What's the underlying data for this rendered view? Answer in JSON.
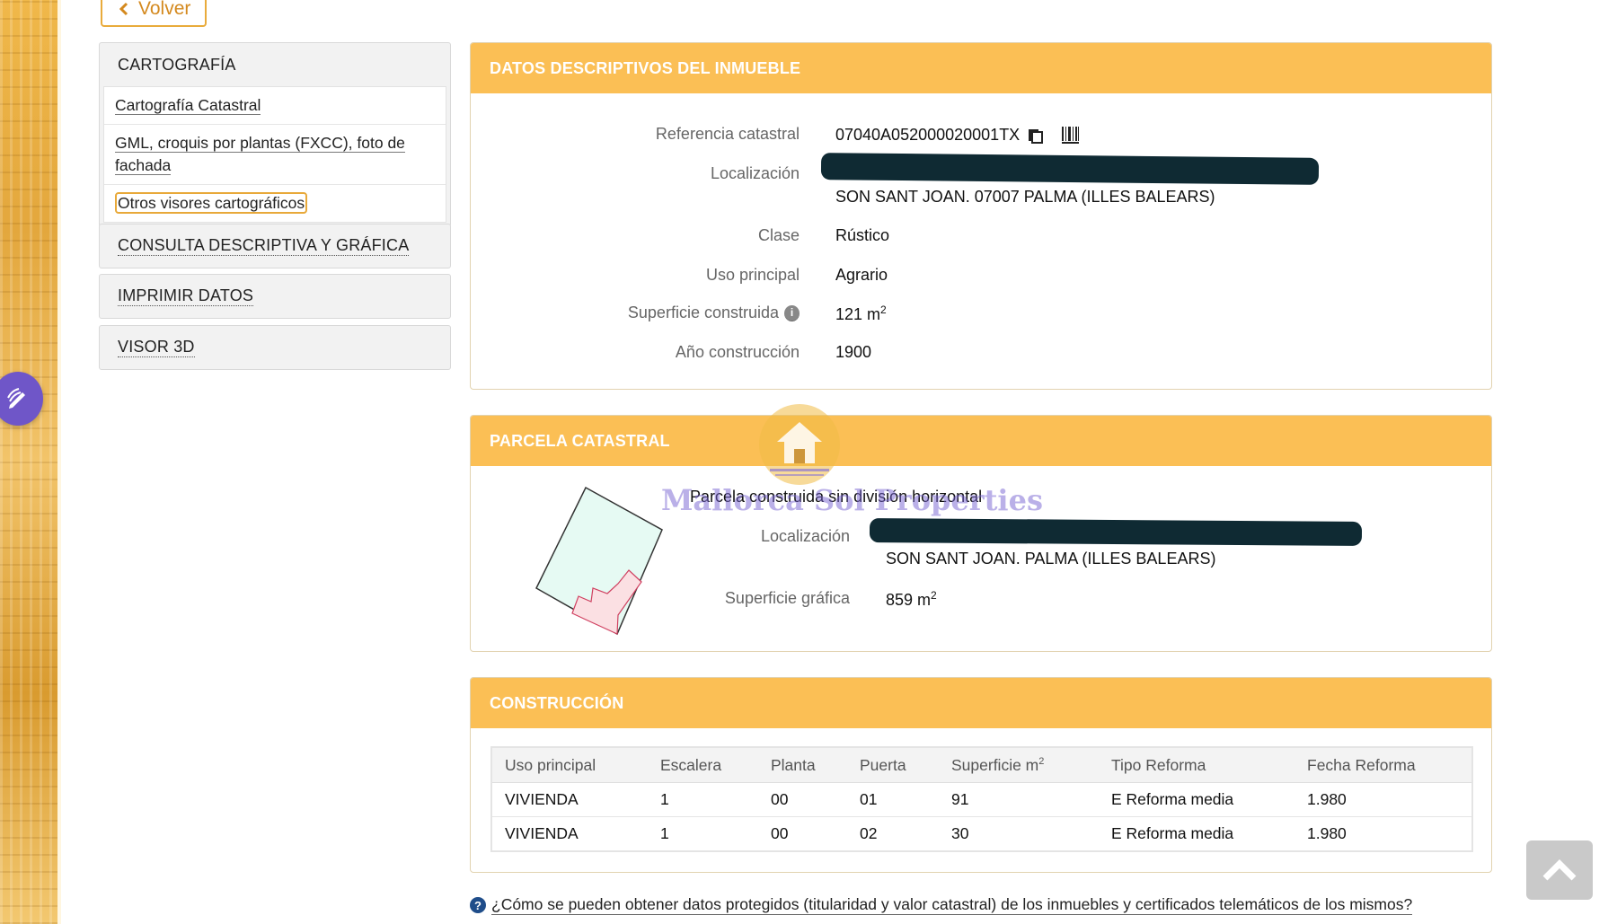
{
  "back": {
    "label": "Volver"
  },
  "sidebar": {
    "cartografia": {
      "title": "CARTOGRAFÍA",
      "items": [
        {
          "label": "Cartografía Catastral"
        },
        {
          "label": "GML, croquis por plantas (FXCC), foto de fachada"
        },
        {
          "label": "Otros visores cartográficos"
        }
      ]
    },
    "consulta": {
      "title": "CONSULTA DESCRIPTIVA Y GRÁFICA"
    },
    "imprimir": {
      "title": "IMPRIMIR DATOS"
    },
    "visor3d": {
      "title": "VISOR 3D"
    }
  },
  "datos": {
    "title": "DATOS DESCRIPTIVOS DEL INMUEBLE",
    "referencia_label": "Referencia catastral",
    "referencia_value": "07040A052000020001TX",
    "localizacion_label": "Localización",
    "localizacion_line2": "SON SANT JOAN. 07007 PALMA (ILLES BALEARS)",
    "clase_label": "Clase",
    "clase_value": "Rústico",
    "uso_label": "Uso principal",
    "uso_value": "Agrario",
    "superficie_label": "Superficie construida",
    "superficie_value": "121 m",
    "superficie_sup": "2",
    "anio_label": "Año construcción",
    "anio_value": "1900"
  },
  "parcela": {
    "title": "PARCELA CATASTRAL",
    "subtitle": "Parcela construida sin división horizontal",
    "localizacion_label": "Localización",
    "localizacion_line2": "SON SANT JOAN. PALMA (ILLES BALEARS)",
    "superficie_label": "Superficie gráfica",
    "superficie_value": "859 m",
    "superficie_sup": "2"
  },
  "construccion": {
    "title": "CONSTRUCCIÓN",
    "columns": [
      "Uso principal",
      "Escalera",
      "Planta",
      "Puerta",
      "Superficie m",
      "Tipo Reforma",
      "Fecha Reforma"
    ],
    "superficie_sup": "2",
    "rows": [
      [
        "VIVIENDA",
        "1",
        "00",
        "01",
        "91",
        "E Reforma media",
        "1.980"
      ],
      [
        "VIVIENDA",
        "1",
        "00",
        "02",
        "30",
        "E Reforma media",
        "1.980"
      ]
    ]
  },
  "footer": {
    "question": "¿Cómo se pueden obtener datos protegidos (titularidad y valor catastral) de los inmuebles y certificados telemáticos de los mismos?"
  },
  "watermark": {
    "text": "Mallorca Sol Properties"
  },
  "colors": {
    "accent": "#fbbf55",
    "accent_border": "#e9ab3b",
    "fab": "#6f56c8"
  },
  "icons": [
    "chevron-left-icon",
    "copy-icon",
    "barcode-icon",
    "info-icon",
    "question-icon",
    "chevron-up-icon",
    "pencil-icon",
    "house-logo-icon"
  ]
}
